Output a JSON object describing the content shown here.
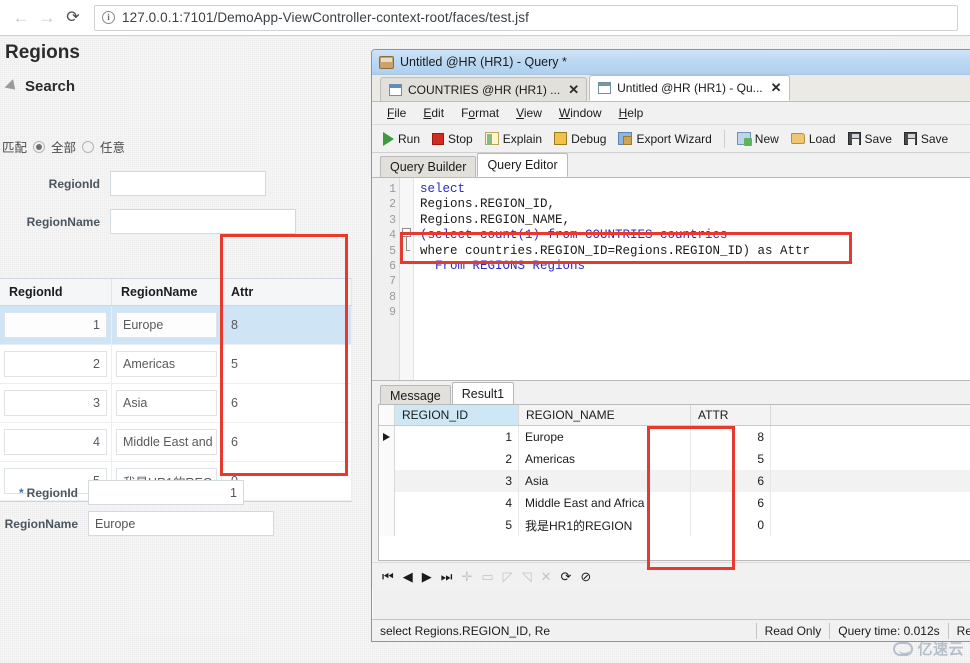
{
  "browser": {
    "back_icon": "arrow-left-icon",
    "forward_icon": "arrow-right-icon",
    "reload_icon": "reload-icon",
    "info_glyph": "i",
    "url": "127.0.0.1:7101/DemoApp-ViewController-context-root/faces/test.jsf"
  },
  "webpage": {
    "title": "Regions",
    "search_section_label": "Search",
    "match": {
      "label": "匹配",
      "options": [
        {
          "label": "全部",
          "selected": true
        },
        {
          "label": "任意",
          "selected": false
        }
      ]
    },
    "search_fields": [
      {
        "label": "RegionId",
        "value": "",
        "placeholder": ""
      },
      {
        "label": "RegionName",
        "value": "",
        "placeholder": ""
      }
    ],
    "table": {
      "columns": [
        "RegionId",
        "RegionName",
        "Attr"
      ],
      "rows": [
        {
          "id": "1",
          "name": "Europe",
          "attr": "8",
          "selected": true
        },
        {
          "id": "2",
          "name": "Americas",
          "attr": "5",
          "selected": false
        },
        {
          "id": "3",
          "name": "Asia",
          "attr": "6",
          "selected": false
        },
        {
          "id": "4",
          "name": "Middle East and",
          "attr": "6",
          "selected": false
        },
        {
          "id": "5",
          "name": "我是HR1的REG",
          "attr": "0",
          "selected": false
        }
      ]
    },
    "detail_fields": [
      {
        "label": "RegionId",
        "value": "1",
        "required": true
      },
      {
        "label": "RegionName",
        "value": "Europe",
        "required": false
      }
    ]
  },
  "sqldev": {
    "window_title": "Untitled @HR (HR1) - Query *",
    "doc_tabs": [
      {
        "label": "COUNTRIES @HR (HR1) ...",
        "active": false,
        "close": "✕"
      },
      {
        "label": "Untitled @HR (HR1) - Qu...",
        "active": true,
        "close": "✕"
      }
    ],
    "menus": [
      "File",
      "Edit",
      "Format",
      "View",
      "Window",
      "Help"
    ],
    "toolbar": [
      {
        "label": "Run",
        "icon": "run-icon"
      },
      {
        "label": "Stop",
        "icon": "stop-icon"
      },
      {
        "label": "Explain",
        "icon": "explain-icon"
      },
      {
        "label": "Debug",
        "icon": "debug-icon"
      },
      {
        "label": "Export Wizard",
        "icon": "export-wizard-icon"
      },
      {
        "label": "New",
        "icon": "new-icon"
      },
      {
        "label": "Load",
        "icon": "load-icon"
      },
      {
        "label": "Save",
        "icon": "save-icon"
      },
      {
        "label": "Save",
        "icon": "save-as-icon"
      }
    ],
    "editor_tabs": [
      {
        "label": "Query Builder",
        "active": false
      },
      {
        "label": "Query Editor",
        "active": true
      }
    ],
    "sql_lines": [
      {
        "n": "1",
        "text": "select"
      },
      {
        "n": "2",
        "text": "Regions.REGION_ID,"
      },
      {
        "n": "3",
        "text": "Regions.REGION_NAME,"
      },
      {
        "n": "4",
        "text": "(select count(1) from COUNTRIES countries"
      },
      {
        "n": "5",
        "text": "where countries.REGION_ID=Regions.REGION_ID) as Attr"
      },
      {
        "n": "6",
        "text": "  From REGIONS Regions"
      },
      {
        "n": "7",
        "text": ""
      },
      {
        "n": "8",
        "text": ""
      },
      {
        "n": "9",
        "text": ""
      }
    ],
    "result_tabs": [
      {
        "label": "Message",
        "active": false
      },
      {
        "label": "Result1",
        "active": true
      }
    ],
    "result_grid": {
      "columns": [
        "REGION_ID",
        "REGION_NAME",
        "ATTR"
      ],
      "rows": [
        {
          "marker": "▶",
          "id": "1",
          "name": "Europe",
          "attr": "8"
        },
        {
          "marker": "",
          "id": "2",
          "name": "Americas",
          "attr": "5"
        },
        {
          "marker": "",
          "id": "3",
          "name": "Asia",
          "attr": "6"
        },
        {
          "marker": "",
          "id": "4",
          "name": "Middle East and Africa",
          "attr": "6"
        },
        {
          "marker": "",
          "id": "5",
          "name": "我是HR1的REGION",
          "attr": "0"
        }
      ]
    },
    "nav_icons": [
      "⏮",
      "◀",
      "▶",
      "⏭",
      "✛",
      "▭",
      "◸",
      "◹",
      "✕",
      "⟳",
      "⊘"
    ],
    "statusbar": {
      "sql_preview": "select  Regions.REGION_ID, Re",
      "mode": "Read Only",
      "query_time": "Query time: 0.012s",
      "extra": "Re"
    }
  },
  "watermark": {
    "text": "亿速云",
    "icon": "cloud-icon"
  },
  "colors": {
    "annotation_red": "#e8392f",
    "selection_blue": "#cfe4f5",
    "header_blue": "#cde7f5",
    "sql_keyword": "#2b2bc8"
  }
}
